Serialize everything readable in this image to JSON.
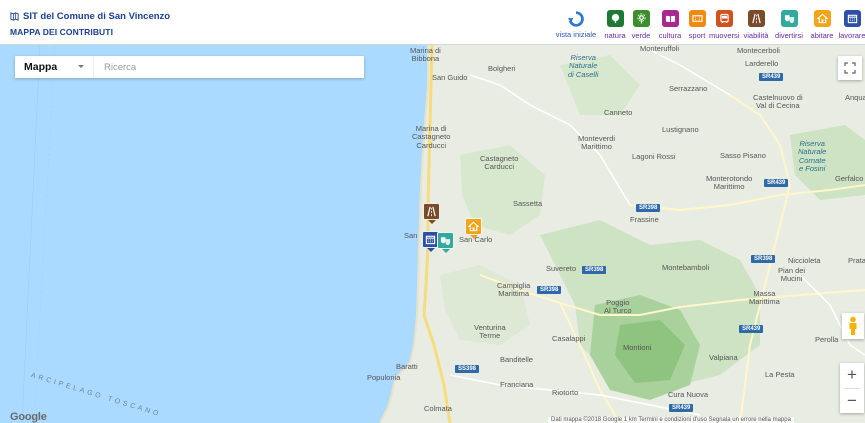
{
  "header": {
    "title": "SIT del Comune di San Vincenzo",
    "subtitle": "MAPPA DEI CONTRIBUTI",
    "vista_label": "vista iniziale"
  },
  "categories": [
    {
      "label": "natura",
      "color": "#1e7a33",
      "icon": "tree-icon"
    },
    {
      "label": "verde",
      "color": "#3b8f2a",
      "icon": "flower-icon"
    },
    {
      "label": "cultura",
      "color": "#a8288f",
      "icon": "book-icon"
    },
    {
      "label": "sport",
      "color": "#f08a12",
      "icon": "ticket-icon"
    },
    {
      "label": "muoversi",
      "color": "#d1521c",
      "icon": "bus-icon"
    },
    {
      "label": "viabilità",
      "color": "#7a4b2a",
      "icon": "road-icon"
    },
    {
      "label": "divertirsi",
      "color": "#33a89c",
      "icon": "masks-icon"
    },
    {
      "label": "abitare",
      "color": "#f2a51a",
      "icon": "house-icon"
    },
    {
      "label": "lavorare",
      "color": "#2d4fa6",
      "icon": "calendar-icon"
    }
  ],
  "controls": {
    "map_type": "Mappa",
    "search_placeholder": "Ricerca"
  },
  "places": {
    "marina_bibbona": "Marina di\nBibbona",
    "bolgheri": "Bolgheri",
    "san_guido": "San Guido",
    "riserva_caselli": "Riserva\nNaturale\ndi Caselli",
    "monteruffoli": "Monteruffoli",
    "montecerboli": "Montecerboli",
    "larderello": "Larderello",
    "serrazzano": "Serrazzano",
    "castelnuovo": "Castelnuovo di\nVal di Cecina",
    "anqua": "Anqua",
    "canneto": "Canneto",
    "marina_castagneto": "Marina di\nCastagneto\nCarducci",
    "lustignano": "Lustignano",
    "monteverdi": "Monteverdi\nMarittimo",
    "castagneto": "Castagneto\nCarducci",
    "lagoni": "Lagoni Rossi",
    "sasso_pisano": "Sasso Pisano",
    "riserva_cornate": "Riserva\nNaturale\nCornate\ne Fosini",
    "gerfalco": "Gerfalco",
    "monterotondo": "Monterotondo\nMarittimo",
    "sassetta": "Sassetta",
    "frassine": "Frassine",
    "san_carlo": "San Carlo",
    "san_v": "San",
    "nicciolete": "Niccioleta",
    "prata": "Prata",
    "pian_mucini": "Pian dei\nMucini",
    "suvereto": "Suvereto",
    "montebamboli": "Montebamboli",
    "campiglia": "Campiglia\nMarittima",
    "massa": "Massa\nMarittima",
    "poggio": "Poggio\nAl Turco",
    "venturina": "Venturina\nTerme",
    "casalappi": "Casalappi",
    "montioni": "Montioni",
    "valpiana": "Valpiana",
    "perolla": "Perolla",
    "banditelle": "Banditelle",
    "baratti": "Baratti",
    "populonia": "Populonia",
    "franciana": "Franciana",
    "la_pesta": "La Pesta",
    "riotorto": "Riotorto",
    "cura_nuova": "Cura Nuova",
    "colmata": "Colmata",
    "arcipelago": "ARCIPELAGO TOSCANO"
  },
  "roads": {
    "sr439a": "SR439",
    "sr439b": "SR439",
    "sr398a": "SR398",
    "sr398b": "SR398",
    "sr398c": "SR398",
    "sr439c": "SR439",
    "ss398": "SS398",
    "sr439d": "SR439",
    "sr398d": "SR398"
  },
  "attribution": {
    "google": "Google",
    "text": "Dati mappa ©2018 Google  1 km      Termini e condizioni d'uso  Segnala un errore nella mappa"
  }
}
